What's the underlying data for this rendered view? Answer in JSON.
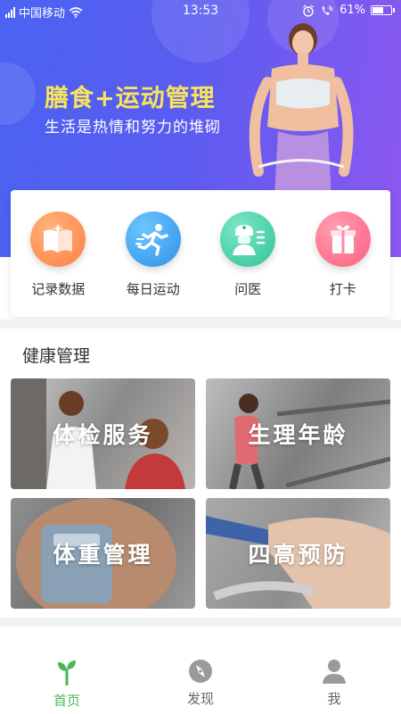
{
  "status_bar": {
    "carrier": "中国移动",
    "time": "13:53",
    "battery_percent": "61%",
    "battery_level": 0.61
  },
  "banner": {
    "title": "膳食+运动管理",
    "subtitle": "生活是热情和努力的堆砌"
  },
  "quick_actions": [
    {
      "label": "记录数据",
      "icon": "book-icon",
      "color": "#ff8a4c"
    },
    {
      "label": "每日运动",
      "icon": "runner-icon",
      "color": "#3fa7f0"
    },
    {
      "label": "问医",
      "icon": "nurse-icon",
      "color": "#43cfa7"
    },
    {
      "label": "打卡",
      "icon": "gift-box-icon",
      "color": "#ff6f8a"
    }
  ],
  "health_section": {
    "title": "健康管理",
    "tiles": [
      {
        "label": "体检服务"
      },
      {
        "label": "生理年龄"
      },
      {
        "label": "体重管理"
      },
      {
        "label": "四高预防"
      }
    ]
  },
  "tab_bar": {
    "accent": "#46b854",
    "tabs": [
      {
        "label": "首页",
        "icon": "sprout-icon",
        "active": true
      },
      {
        "label": "发现",
        "icon": "compass-icon",
        "active": false
      },
      {
        "label": "我",
        "icon": "person-icon",
        "active": false
      }
    ]
  }
}
